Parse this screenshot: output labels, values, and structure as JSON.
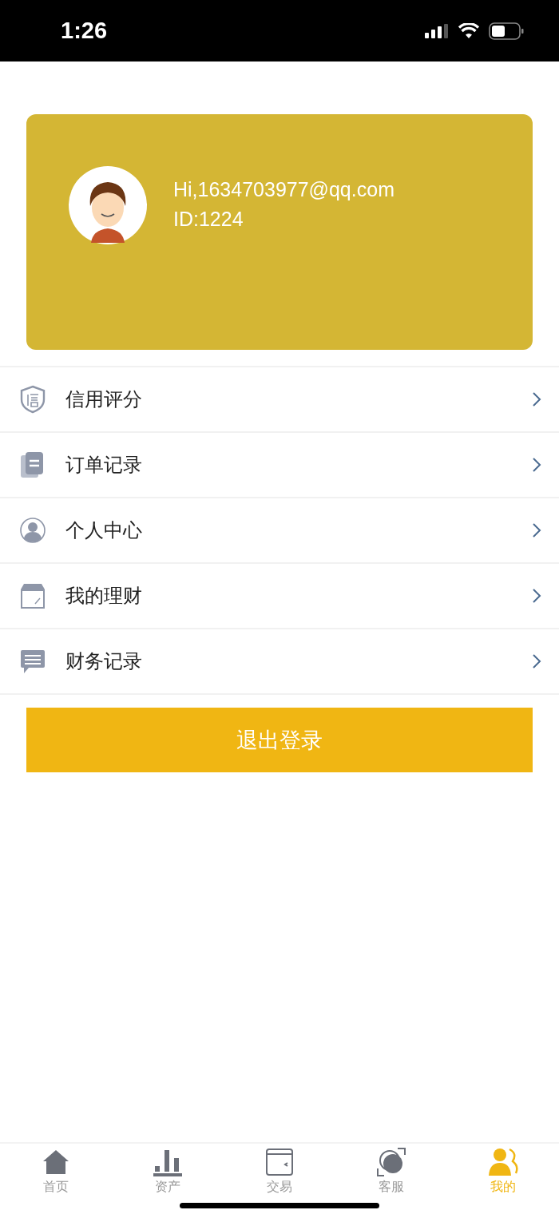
{
  "status_bar": {
    "time": "1:26"
  },
  "profile": {
    "greeting": "Hi,1634703977@qq.com",
    "id": "ID:1224"
  },
  "menu": [
    {
      "label": "信用评分"
    },
    {
      "label": "订单记录"
    },
    {
      "label": "个人中心"
    },
    {
      "label": "我的理财"
    },
    {
      "label": "财务记录"
    }
  ],
  "logout_button": "退出登录",
  "tabs": [
    {
      "label": "首页",
      "selected": false
    },
    {
      "label": "资产",
      "selected": false
    },
    {
      "label": "交易",
      "selected": false
    },
    {
      "label": "客服",
      "selected": false
    },
    {
      "label": "我的",
      "selected": true
    }
  ]
}
